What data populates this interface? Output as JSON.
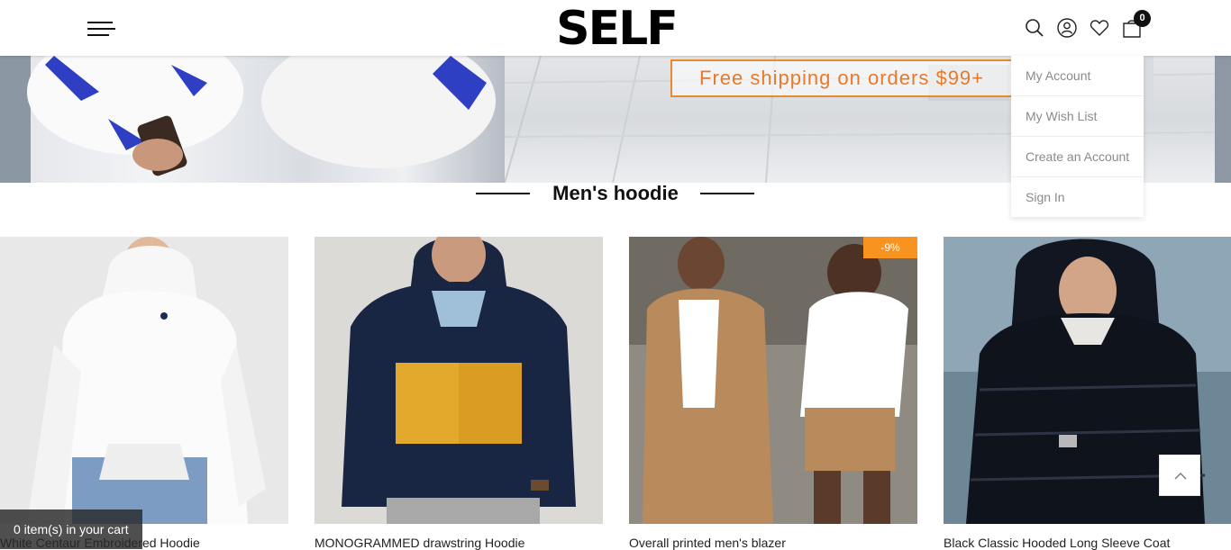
{
  "header": {
    "logo": "SELF",
    "cart_count": "0"
  },
  "banner": {
    "shipping_text": "Free shipping on orders $99+"
  },
  "account_menu": {
    "items": [
      "My Account",
      "My Wish List",
      "Create an Account",
      "Sign In"
    ]
  },
  "section": {
    "title": "Men's hoodie"
  },
  "products": [
    {
      "name": "White Centaur Embroidered Hoodie",
      "badge": ""
    },
    {
      "name": "MONOGRAMMED drawstring Hoodie",
      "badge": ""
    },
    {
      "name": "Overall printed men's blazer",
      "badge": "-9%"
    },
    {
      "name": "Black Classic Hooded Long Sleeve Coat",
      "badge": ""
    }
  ],
  "cart_bar": {
    "text": "0 item(s) in your cart"
  },
  "colors": {
    "accent_orange": "#f7931e",
    "text_dark": "#111111",
    "menu_text": "#8a8a8a"
  },
  "icons": [
    "menu-icon",
    "search-icon",
    "account-icon",
    "heart-icon",
    "cart-icon",
    "chevron-up-icon"
  ]
}
